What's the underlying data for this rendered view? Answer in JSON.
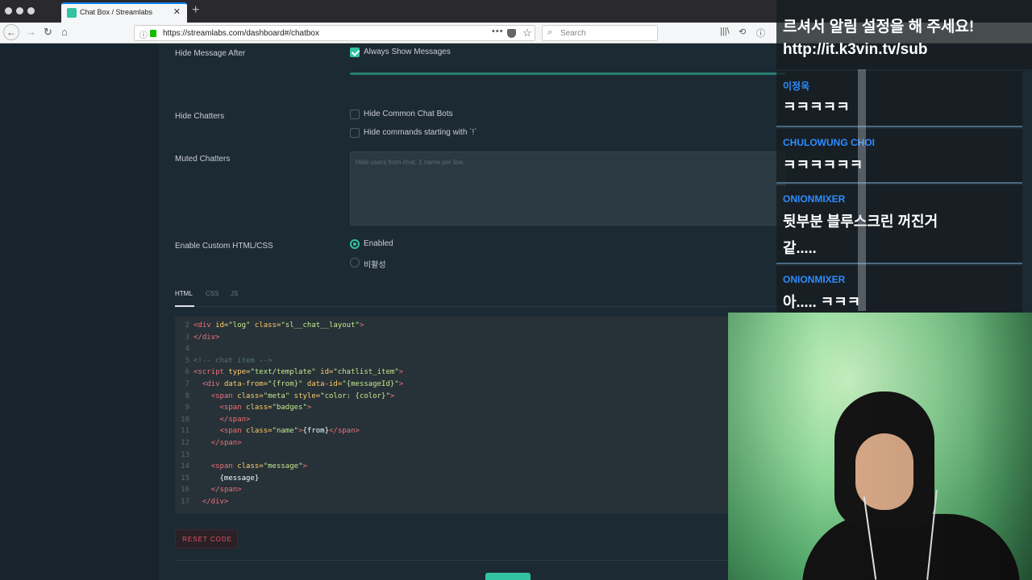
{
  "browser": {
    "tab_title": "Chat Box / Streamlabs",
    "tab_close": "✕",
    "new_tab": "+",
    "url": "https://streamlabs.com/dashboard#/chatbox",
    "search_placeholder": "Search"
  },
  "settings": {
    "hide_message_after_label": "Hide Message After",
    "always_show_messages": "Always Show Messages",
    "always_show_checked": true,
    "hide_chatters_label": "Hide Chatters",
    "hide_common_bots": "Hide Common Chat Bots",
    "hide_commands": "Hide commands starting with `!`",
    "muted_chatters_label": "Muted Chatters",
    "muted_placeholder": "Hide users from chat. 1 name per line.",
    "custom_html_label": "Enable Custom HTML/CSS",
    "enabled_option": "Enabled",
    "disabled_option": "비활성",
    "selected_option": "Enabled"
  },
  "code_tabs": [
    "HTML",
    "CSS",
    "JS"
  ],
  "active_code_tab": "HTML",
  "code_lines": [
    {
      "n": "2",
      "parts": [
        [
          "tag",
          "<div "
        ],
        [
          "attr",
          "id="
        ],
        [
          "str",
          "\"log\" "
        ],
        [
          "attr",
          "class="
        ],
        [
          "str",
          "\"sl__chat__layout\""
        ],
        [
          "tag",
          ">"
        ]
      ]
    },
    {
      "n": "3",
      "parts": [
        [
          "tag",
          "</div>"
        ]
      ]
    },
    {
      "n": "4",
      "parts": []
    },
    {
      "n": "5",
      "parts": [
        [
          "cmt",
          "<!-- chat item -->"
        ]
      ]
    },
    {
      "n": "6",
      "parts": [
        [
          "tag",
          "<script "
        ],
        [
          "attr",
          "type="
        ],
        [
          "str",
          "\"text/template\" "
        ],
        [
          "attr",
          "id="
        ],
        [
          "str",
          "\"chatlist_item\""
        ],
        [
          "tag",
          ">"
        ]
      ]
    },
    {
      "n": "7",
      "parts": [
        [
          "txt",
          "  "
        ],
        [
          "tag",
          "<div "
        ],
        [
          "attr",
          "data-from="
        ],
        [
          "str",
          "\"{from}\" "
        ],
        [
          "attr",
          "data-id="
        ],
        [
          "str",
          "\"{messageId}\""
        ],
        [
          "tag",
          ">"
        ]
      ]
    },
    {
      "n": "8",
      "parts": [
        [
          "txt",
          "    "
        ],
        [
          "tag",
          "<span "
        ],
        [
          "attr",
          "class="
        ],
        [
          "str",
          "\"meta\" "
        ],
        [
          "attr",
          "style="
        ],
        [
          "str",
          "\"color: {color}\""
        ],
        [
          "tag",
          ">"
        ]
      ]
    },
    {
      "n": "9",
      "parts": [
        [
          "txt",
          "      "
        ],
        [
          "tag",
          "<span "
        ],
        [
          "attr",
          "class="
        ],
        [
          "str",
          "\"badges\""
        ],
        [
          "tag",
          ">"
        ]
      ]
    },
    {
      "n": "10",
      "parts": [
        [
          "txt",
          "      "
        ],
        [
          "tag",
          "</span>"
        ]
      ]
    },
    {
      "n": "11",
      "parts": [
        [
          "txt",
          "      "
        ],
        [
          "tag",
          "<span "
        ],
        [
          "attr",
          "class="
        ],
        [
          "str",
          "\"name\""
        ],
        [
          "tag",
          ">"
        ],
        [
          "txt",
          "{from}"
        ],
        [
          "tag",
          "</span>"
        ]
      ]
    },
    {
      "n": "12",
      "parts": [
        [
          "txt",
          "    "
        ],
        [
          "tag",
          "</span>"
        ]
      ]
    },
    {
      "n": "13",
      "parts": []
    },
    {
      "n": "14",
      "parts": [
        [
          "txt",
          "    "
        ],
        [
          "tag",
          "<span "
        ],
        [
          "attr",
          "class="
        ],
        [
          "str",
          "\"message\""
        ],
        [
          "tag",
          ">"
        ]
      ]
    },
    {
      "n": "15",
      "parts": [
        [
          "txt",
          "      {message}"
        ]
      ]
    },
    {
      "n": "16",
      "parts": [
        [
          "txt",
          "    "
        ],
        [
          "tag",
          "</span>"
        ]
      ]
    },
    {
      "n": "17",
      "parts": [
        [
          "txt",
          "  "
        ],
        [
          "tag",
          "</div>"
        ]
      ]
    }
  ],
  "reset_button": "RESET CODE",
  "overlay": {
    "line1": "르셔서 알림 설정을 해 주세요!",
    "line2": "http://it.k3vin.tv/sub",
    "messages": [
      {
        "name": "이정욱",
        "lines": [
          "ㅋㅋㅋㅋㅋ"
        ]
      },
      {
        "name": "CHULOWUNG CHOI",
        "lines": [
          "ㅋㅋㅋㅋㅋㅋ"
        ]
      },
      {
        "name": "ONIONMIXER",
        "lines": [
          "뒷부분 블루스크린 꺼진거",
          "같....."
        ]
      },
      {
        "name": "ONIONMIXER",
        "lines": [
          "아..... ㅋㅋㅋ"
        ]
      }
    ]
  },
  "colors": {
    "accent": "#31c3a2",
    "chat_name": "#2d8cff",
    "reset": "#e45469"
  }
}
